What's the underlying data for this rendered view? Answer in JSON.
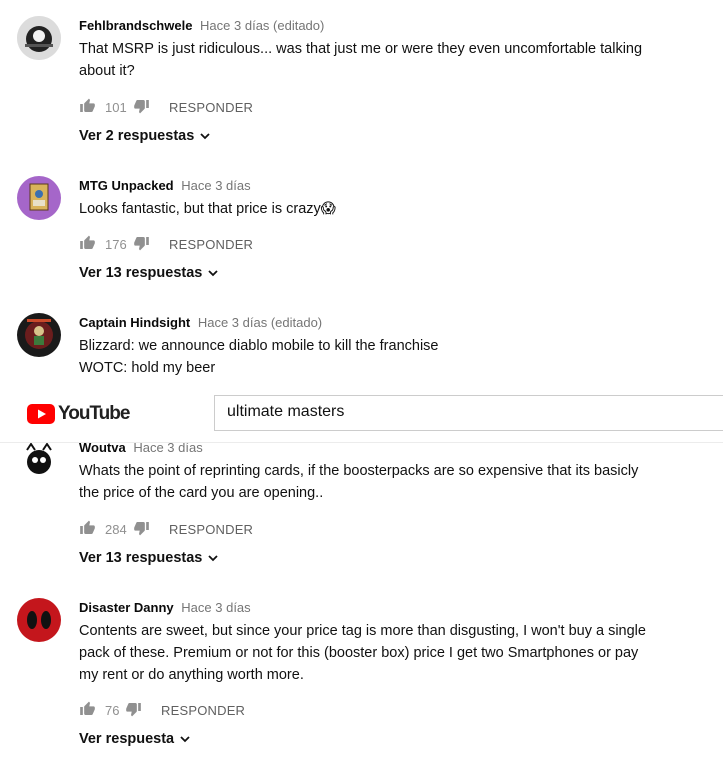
{
  "masthead": {
    "logo_text": "YouTube",
    "search_value": "ultimate masters"
  },
  "comments": [
    {
      "author": "Fehlbrandschwele",
      "time": "Hace 3 días (editado)",
      "lines": [
        "That MSRP is just ridiculous... was that just me or were they even uncomfortable talking",
        "about it?"
      ],
      "likes": "101",
      "reply_label": "RESPONDER",
      "replies_label": "Ver 2 respuestas"
    },
    {
      "author": "MTG Unpacked",
      "time": "Hace 3 días",
      "lines": [
        "Looks fantastic, but that price is crazy😱"
      ],
      "likes": "176",
      "reply_label": "RESPONDER",
      "replies_label": "Ver 13 respuestas"
    },
    {
      "author": "Captain Hindsight",
      "time": "Hace 3 días (editado)",
      "lines": [
        "Blizzard: we announce diablo mobile to kill the franchise",
        "WOTC: hold my beer"
      ]
    },
    {
      "author": "Woutva",
      "time": "Hace 3 días",
      "lines": [
        "Whats the point of reprinting cards, if the boosterpacks are so expensive that its basicly",
        "the price of the card you are opening.."
      ],
      "likes": "284",
      "reply_label": "RESPONDER",
      "replies_label": "Ver 13 respuestas"
    },
    {
      "author": "Disaster Danny",
      "time": "Hace 3 días",
      "lines": [
        "Contents are sweet, but since your price tag is more than disgusting, I won't buy a single",
        "pack of these. Premium or not for this (booster box) price I get two Smartphones or pay",
        "my rent or do anything worth more."
      ],
      "likes": "76",
      "reply_label": "RESPONDER",
      "replies_label": "Ver respuesta"
    }
  ]
}
